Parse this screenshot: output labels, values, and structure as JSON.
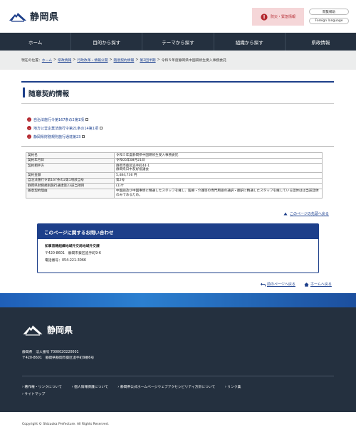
{
  "header": {
    "logo_text": "静岡県",
    "emergency_label": "防災・緊急情報",
    "site_view_label": "閲覧補助",
    "foreign_label": "Foreign language"
  },
  "nav": [
    "ホーム",
    "目的から探す",
    "テーマから探す",
    "組織から探す",
    "県政情報"
  ],
  "breadcrumb": {
    "prefix": "現在の位置：",
    "items": [
      "ホーム",
      "県政情報",
      "行政改革・情報公開",
      "随意契約情報",
      "第2回半期",
      "令和５年度静岡県中国研修生受入事務委託"
    ],
    "separator": ">"
  },
  "page_title": "随意契約情報",
  "law_links": [
    "自治法施行令第167条の2第1項",
    "地方公営企業法施行令第21条の14第1項",
    "静岡県財務規則施行通達第23"
  ],
  "table": [
    {
      "key": "契約名",
      "value": "令和５年度静岡県中国研修生受入事務委託"
    },
    {
      "key": "契約年月日",
      "value": "令和05年08月21日"
    },
    {
      "key": "契約相手方",
      "value": "静岡市葵区追手町44-1\n静岡県日中友好協議会"
    },
    {
      "key": "契約金額",
      "value": "5,484,736 円"
    },
    {
      "key": "自治法施行令第167条の2第1項該当号",
      "value": "第2号"
    },
    {
      "key": "静岡県財務規則施行通達第23該当項目",
      "value": "(1)ケ"
    },
    {
      "key": "随意契約理由",
      "value": "中国語及び中国事情に精通したスタッフを擁し、医療・介護等の専門用語の通訳・翻訳に精通したスタッフを擁している団体はは当該団体のみであるため。"
    }
  ],
  "page_top_label": "このページの先頭へ戻る",
  "contact": {
    "heading": "このページに関するお問い合わせ",
    "org": "知事直轄組織地域外交局地域外交課",
    "address": "〒420-8601　静岡市葵区追手町9-6",
    "phone": "電話番号：054-221-3066"
  },
  "bottom_nav": {
    "back_label": "前のページへ戻る",
    "home_label": "ホームへ戻る"
  },
  "footer": {
    "logo_text": "静岡県",
    "corp_number": "静岡県　法人番号 7000020220001",
    "address": "〒420-8601　静岡県静岡市葵区追手町9番6号",
    "links": [
      "著作権・リンクについて",
      "個人情報保護について",
      "静岡県公式ホームページウェブアクセシビリティ方針について",
      "リンク集",
      "サイトマップ"
    ],
    "copyright": "Copyright © Shizuoka Prefecture. All Rights Reserved."
  },
  "colors": {
    "nav_bg": "#24303f",
    "accent_blue": "#1d3f8a",
    "emergency_bg": "#f5d6d8",
    "emergency_red": "#b3262d"
  }
}
